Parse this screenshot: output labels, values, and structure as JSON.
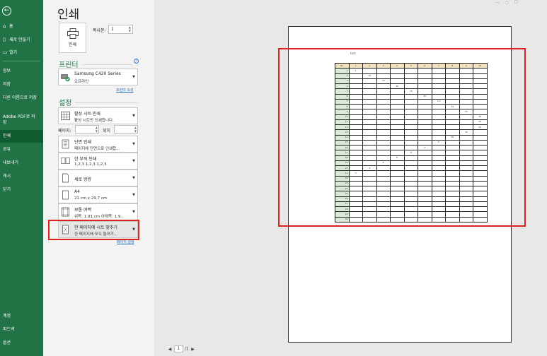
{
  "sidebar": {
    "back": "←",
    "items": [
      {
        "label": "홈",
        "icon": "home-icon",
        "glyph": "⌂"
      },
      {
        "label": "새로 만들기",
        "icon": "new-document-icon",
        "glyph": "▯"
      },
      {
        "label": "열기",
        "icon": "open-folder-icon",
        "glyph": "▭"
      },
      {
        "label": "정보"
      },
      {
        "label": "저장"
      },
      {
        "label": "다른 이름으로 저장"
      },
      {
        "label": "Adobe PDF로 저장"
      },
      {
        "label": "인쇄",
        "active": true
      },
      {
        "label": "공유"
      },
      {
        "label": "내보내기"
      },
      {
        "label": "게시"
      },
      {
        "label": "닫기"
      },
      {
        "label": "계정"
      },
      {
        "label": "피드백"
      },
      {
        "label": "옵션"
      }
    ]
  },
  "title": "인쇄",
  "print_button": "인쇄",
  "copies": {
    "label": "복사본:",
    "value": "1"
  },
  "printer_section": "프린터",
  "printer": {
    "name": "Samsung C420 Series",
    "status": "오프라인"
  },
  "printer_properties": "프린터 속성",
  "settings_section": "설정",
  "settings": {
    "what": {
      "l1": "활성 시트 인쇄",
      "l2": "활성 시트만 인쇄합니다."
    },
    "pages_label": "페이지:",
    "to_label": "위치",
    "sides": {
      "l1": "단면 인쇄",
      "l2": "페이지에 단면으로 인쇄합..."
    },
    "collate": {
      "l1": "한 부씩 인쇄",
      "l2": "1,2,3    1,2,3    1,2,3"
    },
    "orientation": {
      "l1": "세로 방향"
    },
    "paper": {
      "l1": "A4",
      "l2": "21 cm x 29.7 cm"
    },
    "margins": {
      "l1": "보통 여백",
      "l2": "위쪽: 1.91 cm 아래쪽: 1.9..."
    },
    "scaling": {
      "l1": "한 페이지에 시트 맞추기",
      "l2": "한 페이지에 모두 들어가..."
    }
  },
  "page_setup": "페이지 설정",
  "preview": {
    "sheet_title": "test",
    "col_header_first": "No.",
    "col_headers": [
      "1",
      "2",
      "3",
      "4",
      "5",
      "6",
      "7",
      "8",
      "9",
      "10"
    ],
    "row_numbers": [
      "1",
      "2",
      "3",
      "4",
      "5",
      "6",
      "7",
      "8",
      "9",
      "10",
      "11",
      "12",
      "13",
      "14",
      "15",
      "16",
      "17",
      "18",
      "19",
      "20",
      "21",
      "22",
      "23",
      "24",
      "25",
      "26",
      "27",
      "28",
      "29",
      "30"
    ],
    "cells": [
      {
        "r": 1,
        "c": 0,
        "v": "1"
      },
      {
        "r": 2,
        "c": 1,
        "v": "12"
      },
      {
        "r": 3,
        "c": 2,
        "v": "23"
      },
      {
        "r": 4,
        "c": 3,
        "v": "40"
      },
      {
        "r": 5,
        "c": 4,
        "v": "10"
      },
      {
        "r": 6,
        "c": 5,
        "v": "30"
      },
      {
        "r": 7,
        "c": 6,
        "v": "12"
      },
      {
        "r": 8,
        "c": 7,
        "v": "34"
      },
      {
        "r": 9,
        "c": 8,
        "v": "50"
      },
      {
        "r": 10,
        "c": 9,
        "v": "30"
      },
      {
        "r": 11,
        "c": 9,
        "v": "20"
      },
      {
        "r": 12,
        "c": 9,
        "v": "22"
      },
      {
        "r": 13,
        "c": 8,
        "v": "30"
      },
      {
        "r": 14,
        "c": 7,
        "v": "20"
      },
      {
        "r": 15,
        "c": 6,
        "v": "2"
      },
      {
        "r": 16,
        "c": 5,
        "v": "3"
      },
      {
        "r": 17,
        "c": 4,
        "v": "8"
      },
      {
        "r": 18,
        "c": 3,
        "v": "8"
      },
      {
        "r": 19,
        "c": 2,
        "v": "8"
      },
      {
        "r": 20,
        "c": 1,
        "v": "9"
      },
      {
        "r": 21,
        "c": 0,
        "v": "3"
      }
    ]
  },
  "pager": {
    "current": "1",
    "total": "/1",
    "prev": "◀",
    "next": "▶"
  }
}
